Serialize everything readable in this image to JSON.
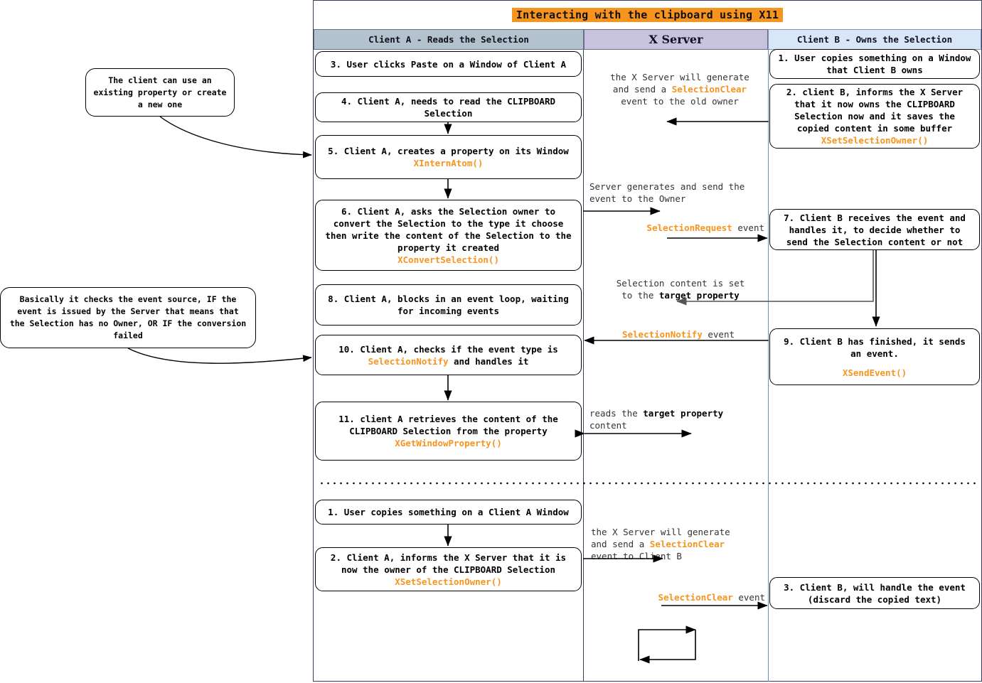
{
  "title": "Interacting with the clipboard using X11",
  "columns": {
    "client_a": "Client A - Reads the Selection",
    "x_server": "X Server",
    "client_b": "Client B - Owns the Selection"
  },
  "notes": [
    {
      "id": "note-property",
      "text": "The client can use an existing property or create a new one"
    },
    {
      "id": "note-event-source",
      "text": "Basically it checks the event source, IF the event is issued by the Server that means that the Selection has no Owner, OR IF the conversion failed"
    }
  ],
  "client_a_boxes": [
    {
      "id": "a3",
      "text": "3. User clicks Paste on a Window of Client A",
      "api": ""
    },
    {
      "id": "a4",
      "text": "4. Client A, needs to read the CLIPBOARD Selection",
      "api": ""
    },
    {
      "id": "a5",
      "text": "5. Client A, creates a property on its Window",
      "api": "XInternAtom()"
    },
    {
      "id": "a6",
      "text": "6. Client A, asks the Selection owner to convert the Selection to the type it choose then write the content of the Selection to the property it created",
      "api": "XConvertSelection()"
    },
    {
      "id": "a8",
      "text": "8. Client A, blocks in an event loop, waiting for incoming events",
      "api": ""
    },
    {
      "id": "a10",
      "text_before": "10. Client A, checks if the event type is ",
      "event": "SelectionNotify",
      "text_after": " and handles it",
      "api": ""
    },
    {
      "id": "a11",
      "text": "11. client A retrieves the content of the CLIPBOARD Selection from the property",
      "api": "XGetWindowProperty()"
    },
    {
      "id": "a1b",
      "text": "1. User copies something on a Client A Window",
      "api": ""
    },
    {
      "id": "a2b",
      "text": "2. Client A, informs the X Server that it is now the owner of the CLIPBOARD Selection",
      "api": "XSetSelectionOwner()"
    }
  ],
  "client_b_boxes": [
    {
      "id": "b1",
      "text": "1. User copies something on a Window that Client B owns",
      "api": ""
    },
    {
      "id": "b2",
      "text": "2. client B, informs the X Server that it now owns the CLIPBOARD Selection now and it saves the copied content in some buffer",
      "api": "XSetSelectionOwner()"
    },
    {
      "id": "b7",
      "text": "7. Client B receives the event and handles it, to decide whether to send the Selection content or not",
      "api": ""
    },
    {
      "id": "b9",
      "text": "9. Client B has finished, it sends an event.",
      "api": "XSendEvent()"
    },
    {
      "id": "b3",
      "text": "3. Client B, will handle the event (discard the copied text)",
      "api": ""
    }
  ],
  "server_labels": {
    "clear_top_l1": "the X Server will generate",
    "clear_top_l2_pre": "and send a ",
    "clear_top_l2_ev": "SelectionClear",
    "clear_top_l3": "event to the old owner",
    "generate_l1": "Server generates and send the",
    "generate_l2": "event to the Owner",
    "selection_request_ev": "SelectionRequest",
    "selection_request_suffix": " event",
    "content_set_l1": "Selection content is set",
    "content_set_l2_pre": "to the ",
    "content_set_l2_b": "target property",
    "selection_notify_ev": "SelectionNotify",
    "selection_notify_suffix": " event",
    "reads_l1_pre": "reads the ",
    "reads_l1_b": "target property",
    "reads_l2": "content",
    "clear_bottom_l1": "the X Server will generate",
    "clear_bottom_l2_pre": "and send a ",
    "clear_bottom_l2_ev": "SelectionClear",
    "clear_bottom_l3": "event to Client B",
    "selection_clear_ev": "SelectionClear",
    "selection_clear_suffix": " event"
  },
  "colors": {
    "accent": "#f7941e",
    "header_a": "#b3c2cc",
    "header_s": "#c7c2dd",
    "header_b": "#d8e6f7",
    "arrow": "#000000",
    "arrow_gray": "#555555"
  }
}
